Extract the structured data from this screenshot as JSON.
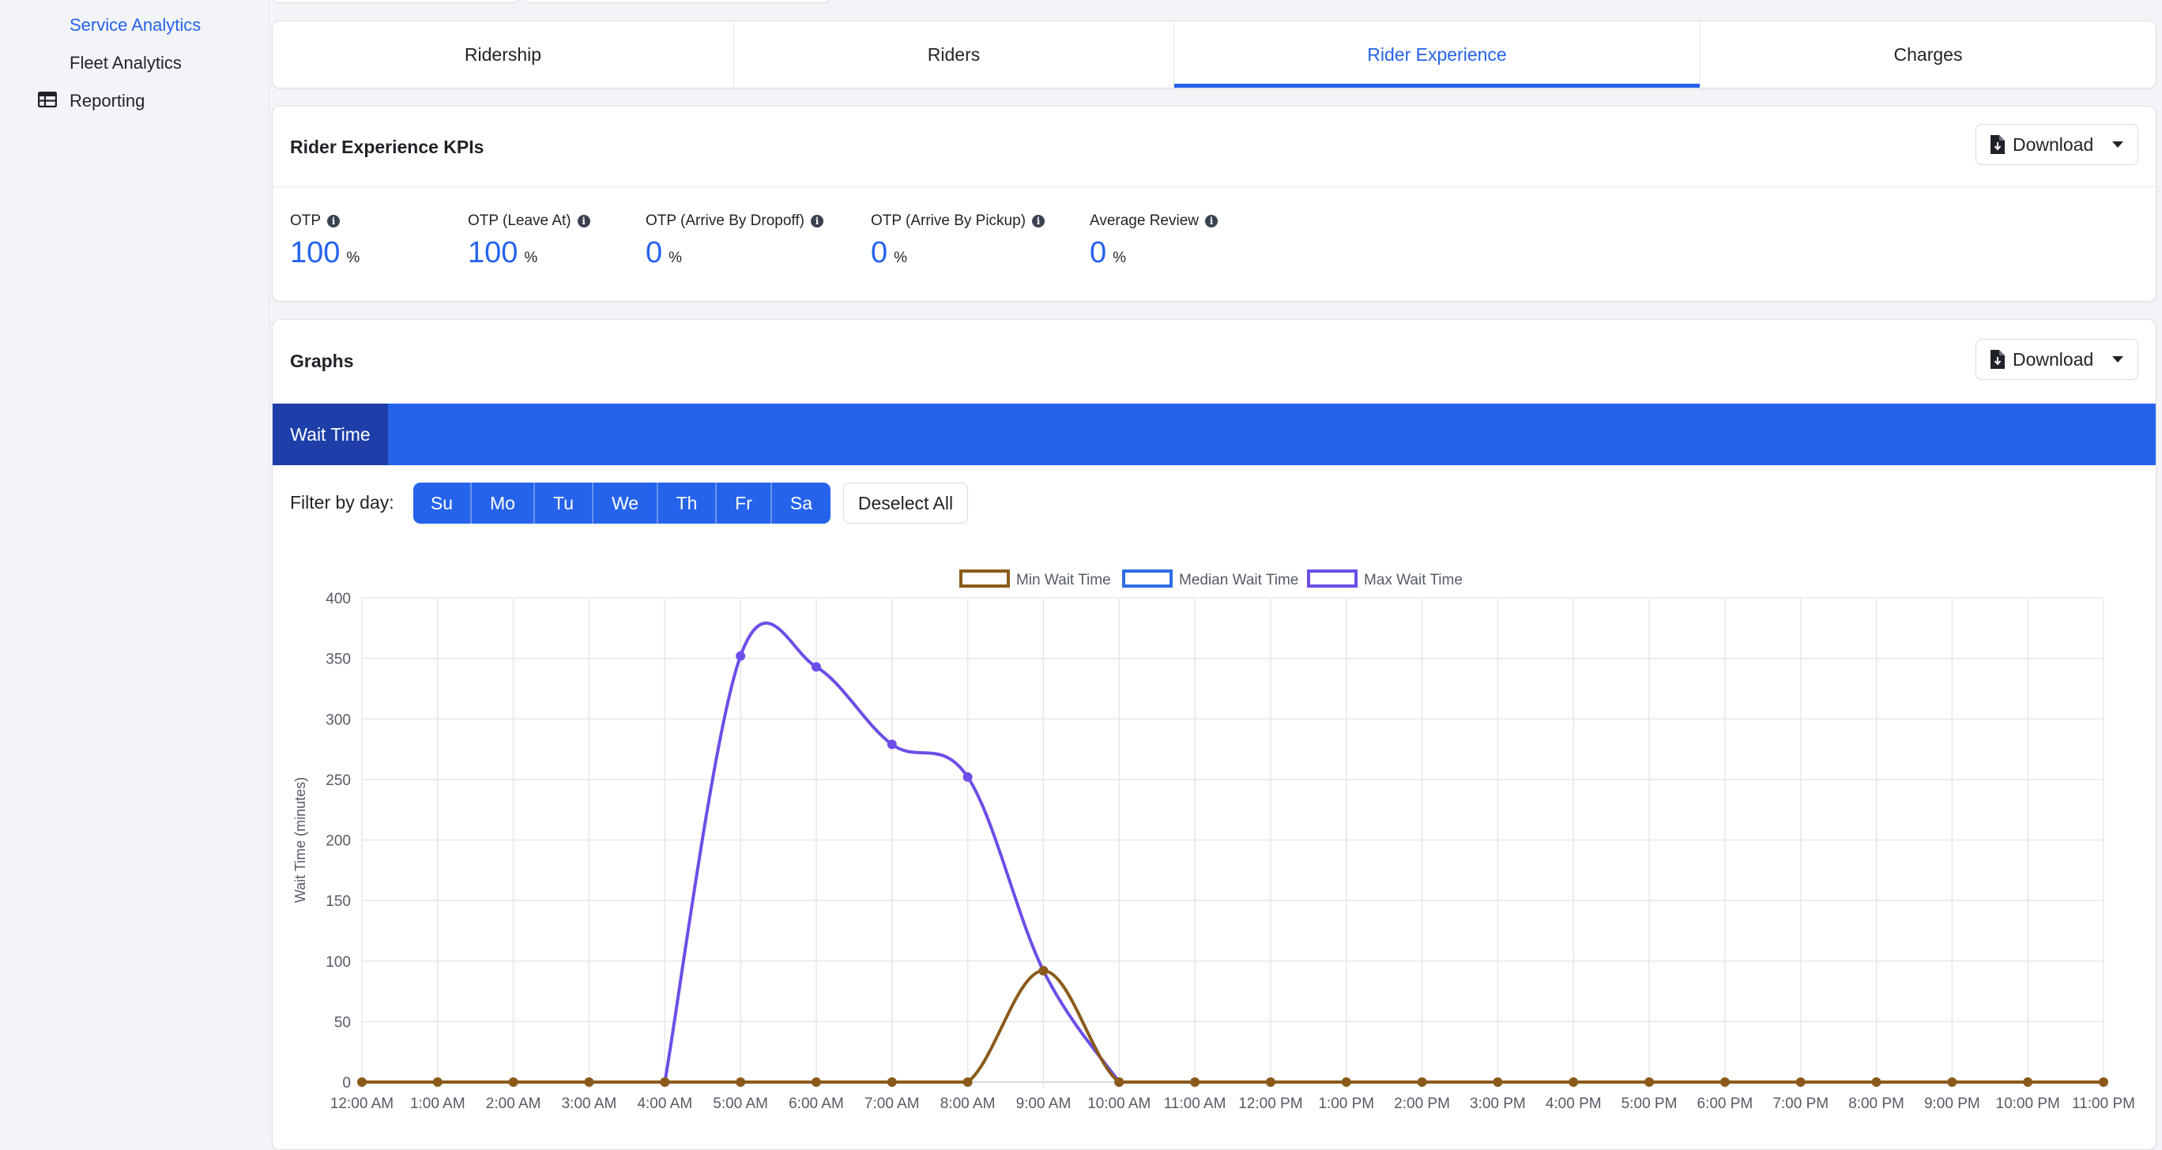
{
  "sidebar": {
    "items": [
      {
        "label": "Service Analytics"
      },
      {
        "label": "Fleet Analytics"
      },
      {
        "label": "Reporting"
      }
    ]
  },
  "tabs": [
    {
      "label": "Ridership"
    },
    {
      "label": "Riders"
    },
    {
      "label": "Rider Experience"
    },
    {
      "label": "Charges"
    }
  ],
  "active_tab": "Rider Experience",
  "kpis": {
    "title": "Rider Experience KPIs",
    "download_label": "Download",
    "items": [
      {
        "label": "OTP",
        "value": "100",
        "unit": "%"
      },
      {
        "label": "OTP (Leave At)",
        "value": "100",
        "unit": "%"
      },
      {
        "label": "OTP (Arrive By Dropoff)",
        "value": "0",
        "unit": "%"
      },
      {
        "label": "OTP (Arrive By Pickup)",
        "value": "0",
        "unit": "%"
      },
      {
        "label": "Average Review",
        "value": "0",
        "unit": "%"
      }
    ]
  },
  "graphs": {
    "title": "Graphs",
    "download_label": "Download",
    "subtab_label": "Wait Time",
    "filter_label": "Filter by day:",
    "days": [
      "Su",
      "Mo",
      "Tu",
      "We",
      "Th",
      "Fr",
      "Sa"
    ],
    "deselect_label": "Deselect All"
  },
  "colors": {
    "accent": "#2563eb",
    "min_series": "#8b5a1a",
    "median_series": "#2f6ce5",
    "max_series": "#6c4ee8"
  },
  "icons": {
    "reporting": "table-icon",
    "download": "file-download-icon",
    "info": "info-icon",
    "dropdown": "caret-down-icon"
  },
  "chart_data": {
    "type": "line",
    "title": "",
    "xlabel": "",
    "ylabel": "Wait Time (minutes)",
    "categories": [
      "12:00 AM",
      "1:00 AM",
      "2:00 AM",
      "3:00 AM",
      "4:00 AM",
      "5:00 AM",
      "6:00 AM",
      "7:00 AM",
      "8:00 AM",
      "9:00 AM",
      "10:00 AM",
      "11:00 AM",
      "12:00 PM",
      "1:00 PM",
      "2:00 PM",
      "3:00 PM",
      "4:00 PM",
      "5:00 PM",
      "6:00 PM",
      "7:00 PM",
      "8:00 PM",
      "9:00 PM",
      "10:00 PM",
      "11:00 PM"
    ],
    "ylim": [
      0,
      400
    ],
    "yticks": [
      0,
      50,
      100,
      150,
      200,
      250,
      300,
      350,
      400
    ],
    "grid": true,
    "legend_position": "top",
    "series": [
      {
        "name": "Min Wait Time",
        "values": [
          0,
          0,
          0,
          0,
          0,
          0,
          0,
          0,
          0,
          92,
          0,
          0,
          0,
          0,
          0,
          0,
          0,
          0,
          0,
          0,
          0,
          0,
          0,
          0
        ]
      },
      {
        "name": "Median Wait Time",
        "values": [
          null,
          null,
          null,
          null,
          null,
          null,
          null,
          null,
          null,
          null,
          null,
          null,
          null,
          null,
          null,
          null,
          null,
          null,
          null,
          null,
          null,
          null,
          null,
          null
        ]
      },
      {
        "name": "Max Wait Time",
        "values": [
          null,
          null,
          null,
          null,
          0,
          352,
          343,
          279,
          252,
          92,
          0,
          null,
          null,
          null,
          null,
          null,
          null,
          null,
          null,
          null,
          null,
          null,
          null,
          null
        ]
      }
    ]
  }
}
